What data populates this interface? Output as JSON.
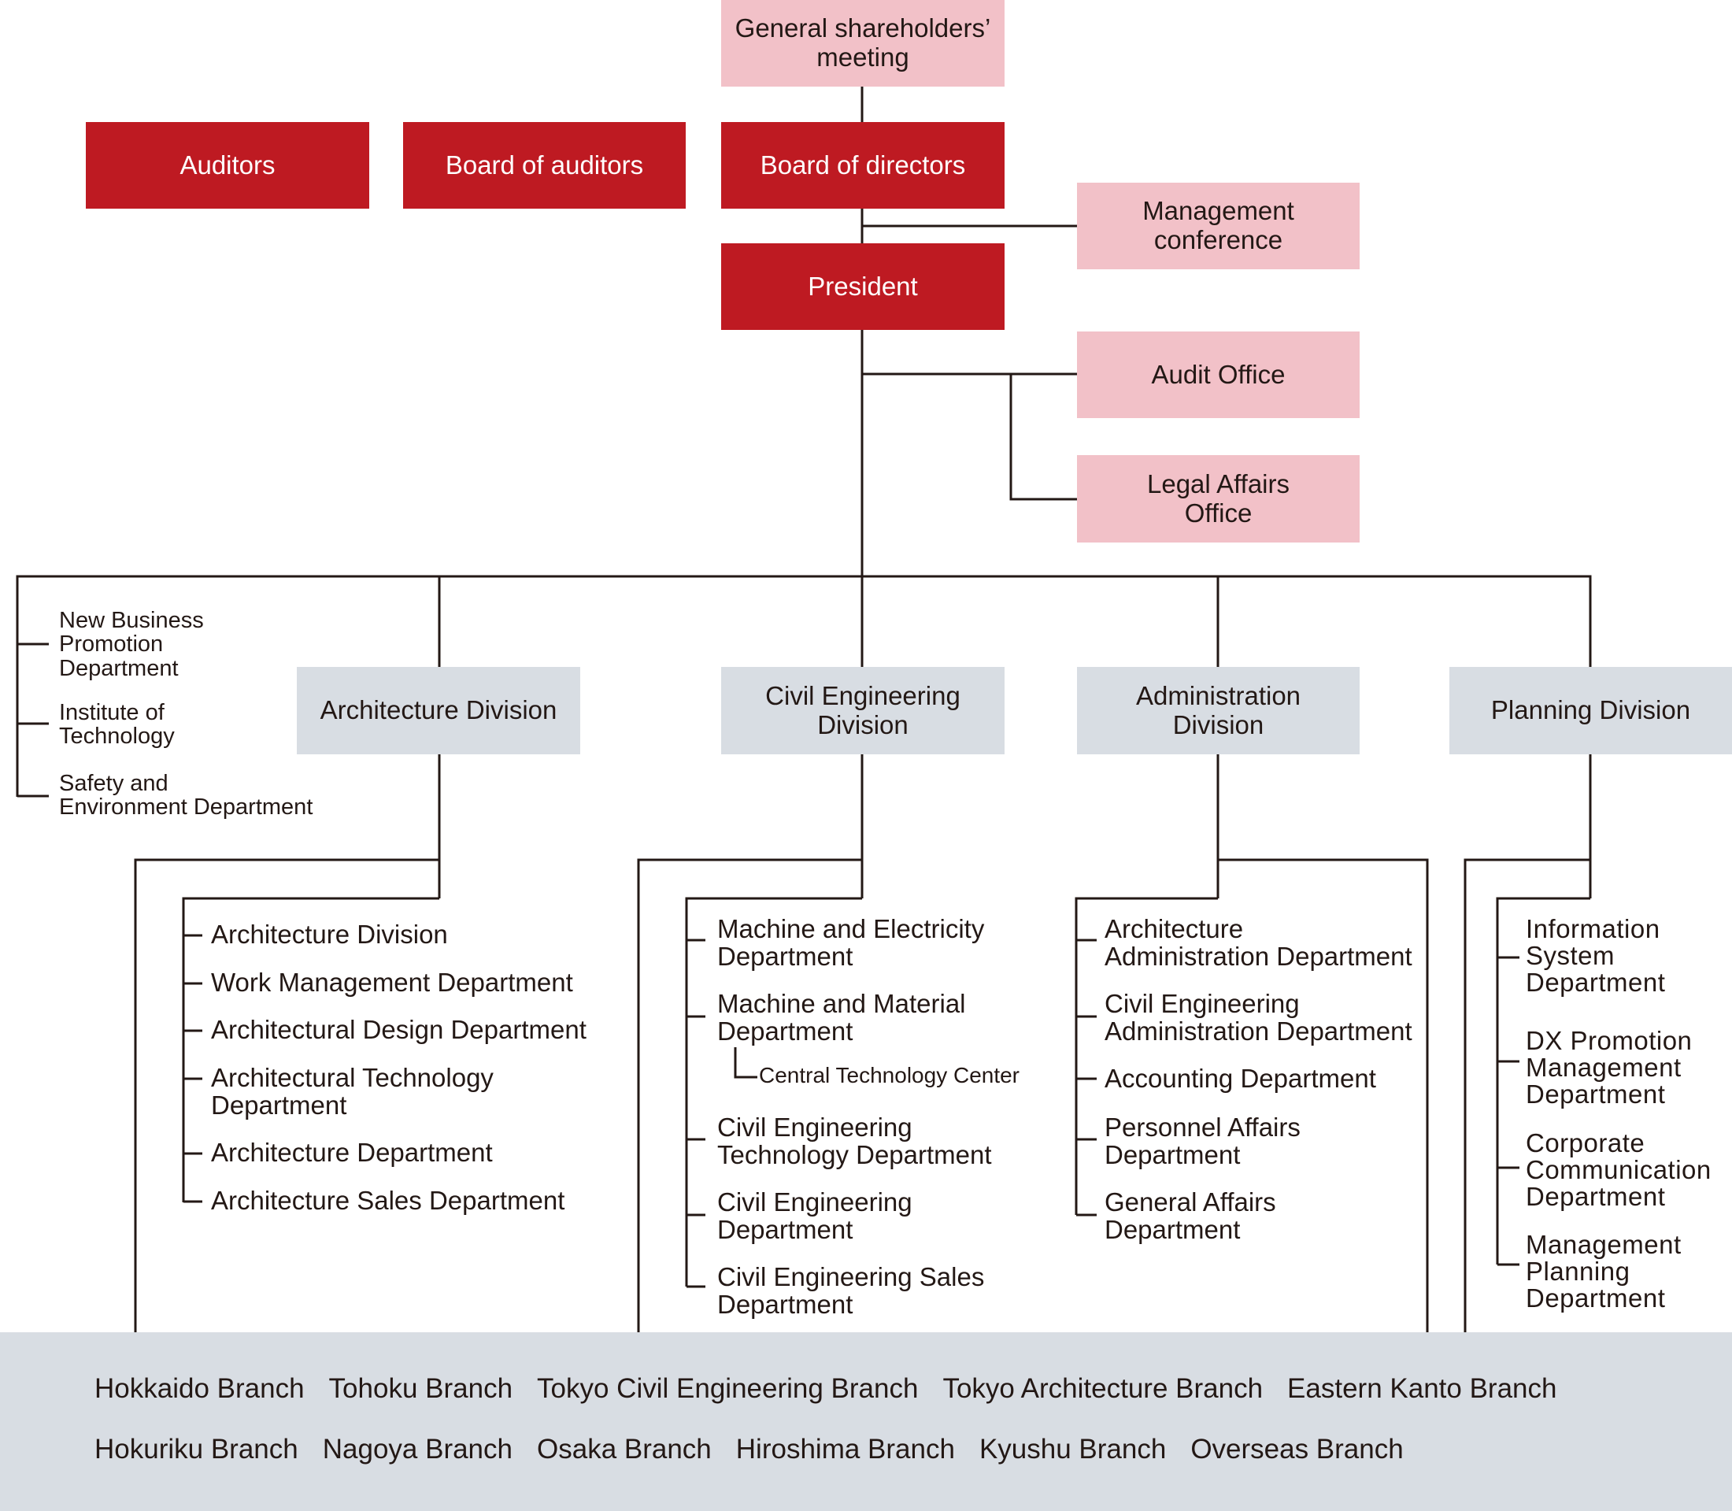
{
  "colors": {
    "executive": "#be1a22",
    "committee": "#f2c1c8",
    "division": "#d8dde3",
    "line": "#231815",
    "text": "#231815"
  },
  "top": {
    "shareholders": "General shareholders’\nmeeting",
    "auditors": "Auditors",
    "board_of_auditors": "Board of auditors",
    "board_of_directors": "Board of directors",
    "management_conference": "Management\nconference",
    "president": "President",
    "audit_office": "Audit Office",
    "legal_affairs_office": "Legal Affairs\nOffice"
  },
  "staff_departments": [
    "New Business\nPromotion\nDepartment",
    "Institute of\nTechnology",
    "Safety and\nEnvironment Department"
  ],
  "divisions": {
    "architecture": {
      "label": "Architecture Division",
      "departments": [
        "Architecture Division",
        "Work Management Department",
        "Architectural Design Department",
        "Architectural Technology\nDepartment",
        "Architecture Department",
        "Architecture Sales Department"
      ]
    },
    "civil_engineering": {
      "label": "Civil Engineering\nDivision",
      "departments": [
        "Machine and Electricity\nDepartment",
        "Machine and Material\nDepartment",
        "Civil Engineering\nTechnology Department",
        "Civil Engineering\nDepartment",
        "Civil Engineering Sales\nDepartment"
      ],
      "sub_unit": "Central Technology Center"
    },
    "administration": {
      "label": "Administration\nDivision",
      "departments": [
        "Architecture\nAdministration Department",
        "Civil Engineering\nAdministration Department",
        "Accounting Department",
        "Personnel Affairs\nDepartment",
        "General Affairs\nDepartment"
      ]
    },
    "planning": {
      "label": "Planning Division",
      "departments": [
        "Information\nSystem\nDepartment",
        "DX Promotion\nManagement\nDepartment",
        "Corporate\nCommunication\nDepartment",
        "Management\nPlanning\nDepartment"
      ]
    }
  },
  "branches": {
    "row1": [
      "Hokkaido Branch",
      "Tohoku Branch",
      "Tokyo Civil Engineering Branch",
      "Tokyo Architecture Branch",
      "Eastern Kanto Branch"
    ],
    "row2": [
      "Hokuriku Branch",
      "Nagoya Branch",
      "Osaka Branch",
      "Hiroshima Branch",
      "Kyushu Branch",
      "Overseas Branch"
    ]
  }
}
